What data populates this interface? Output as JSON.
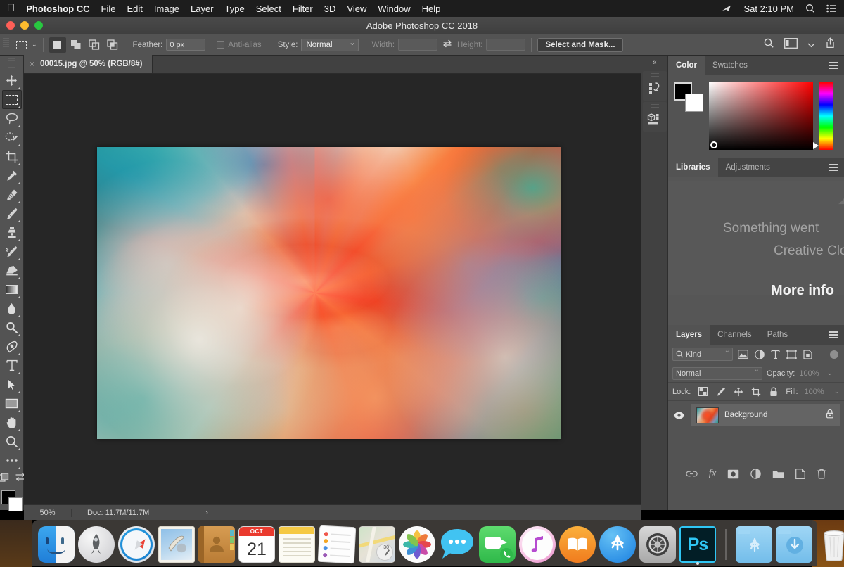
{
  "menubar": {
    "apple_icon": "apple-logo",
    "app_name": "Photoshop CC",
    "items": [
      "File",
      "Edit",
      "Image",
      "Layer",
      "Type",
      "Select",
      "Filter",
      "3D",
      "View",
      "Window",
      "Help"
    ],
    "right": {
      "airplay_icon": "airplay-icon",
      "time": "Sat 2:10 PM",
      "search_icon": "search-icon",
      "control_center_icon": "control-center-icon"
    }
  },
  "titlebar": {
    "title": "Adobe Photoshop CC 2018",
    "close_label": "close",
    "minimize_label": "minimize",
    "zoom_label": "zoom"
  },
  "options_bar": {
    "tool_preset_icon": "rectangular-marquee-icon",
    "selection_modes": [
      "new-selection",
      "add-to-selection",
      "subtract-from-selection",
      "intersect-selection"
    ],
    "feather_label": "Feather:",
    "feather_value": "0 px",
    "antialias_label": "Anti-alias",
    "style_label": "Style:",
    "style_value": "Normal",
    "width_label": "Width:",
    "width_value": "",
    "swap_icon": "swap-arrows-icon",
    "height_label": "Height:",
    "height_value": "",
    "select_and_mask": "Select and Mask...",
    "right_icons": [
      "search-icon",
      "workspace-icon",
      "chevron-down-icon",
      "share-icon"
    ]
  },
  "toolbar": {
    "tools": [
      {
        "name": "move-tool",
        "active": false
      },
      {
        "name": "rectangular-marquee-tool",
        "active": true
      },
      {
        "name": "lasso-tool",
        "active": false
      },
      {
        "name": "quick-selection-tool",
        "active": false
      },
      {
        "name": "crop-tool",
        "active": false
      },
      {
        "name": "eyedropper-tool",
        "active": false
      },
      {
        "name": "spot-healing-brush-tool",
        "active": false
      },
      {
        "name": "brush-tool",
        "active": false
      },
      {
        "name": "clone-stamp-tool",
        "active": false
      },
      {
        "name": "history-brush-tool",
        "active": false
      },
      {
        "name": "eraser-tool",
        "active": false
      },
      {
        "name": "gradient-tool",
        "active": false
      },
      {
        "name": "blur-tool",
        "active": false
      },
      {
        "name": "dodge-tool",
        "active": false
      },
      {
        "name": "pen-tool",
        "active": false
      },
      {
        "name": "horizontal-type-tool",
        "active": false
      },
      {
        "name": "path-selection-tool",
        "active": false
      },
      {
        "name": "rectangle-tool",
        "active": false
      },
      {
        "name": "hand-tool",
        "active": false
      },
      {
        "name": "zoom-tool",
        "active": false
      },
      {
        "name": "edit-toolbar-tool",
        "active": false
      }
    ],
    "quickmask_icon": "quick-mask-icon",
    "screenmode_icon": "screen-mode-icon",
    "foreground_color": "#000000",
    "background_color": "#ffffff"
  },
  "document": {
    "tab_title": "00015.jpg @ 50% (RGB/8#)",
    "tab_close": "×",
    "canvas_bg": "#262626"
  },
  "statusbar": {
    "zoom": "50%",
    "doc_info": "Doc: 11.7M/11.7M",
    "expand_arrow": "›"
  },
  "rail": {
    "collapse_icon": "collapse-panels-icon",
    "items": [
      "history-panel-icon",
      "3d-panel-icon"
    ]
  },
  "color_panel": {
    "tabs": [
      {
        "label": "Color",
        "active": true
      },
      {
        "label": "Swatches",
        "active": false
      }
    ],
    "menu_icon": "panel-menu-icon",
    "foreground": "#000000",
    "background": "#ffffff",
    "field_base_hue": "#ff0000"
  },
  "libraries_panel": {
    "tabs": [
      {
        "label": "Libraries",
        "active": true
      },
      {
        "label": "Adjustments",
        "active": false
      }
    ],
    "menu_icon": "panel-menu-icon",
    "error_line1": "Something went",
    "error_line2": "Creative Clo",
    "more_info_link": "More info"
  },
  "layers_panel": {
    "tabs": [
      {
        "label": "Layers",
        "active": true
      },
      {
        "label": "Channels",
        "active": false
      },
      {
        "label": "Paths",
        "active": false
      }
    ],
    "menu_icon": "panel-menu-icon",
    "filter_label": "Kind",
    "filter_icons": [
      "pixel-filter-icon",
      "adjustment-filter-icon",
      "type-filter-icon",
      "shape-filter-icon",
      "smartobject-filter-icon"
    ],
    "filter_toggle_icon": "filter-enable-toggle",
    "blend_mode": "Normal",
    "opacity_label": "Opacity:",
    "opacity_value": "100%",
    "lock_label": "Lock:",
    "lock_icons": [
      "lock-transparency-icon",
      "lock-image-icon",
      "lock-position-icon",
      "lock-artboard-icon",
      "lock-all-icon"
    ],
    "fill_label": "Fill:",
    "fill_value": "100%",
    "layers": [
      {
        "name": "Background",
        "visible": true,
        "locked": true,
        "eye_icon": "eye-icon",
        "lock_icon": "lock-icon"
      }
    ],
    "bottom_icons": [
      "link-layers-icon",
      "layer-style-fx-icon",
      "layer-mask-icon",
      "adjustment-layer-icon",
      "new-group-icon",
      "new-layer-icon",
      "delete-layer-icon"
    ]
  },
  "dock": {
    "items": [
      {
        "name": "finder",
        "label": "Finder",
        "running": true
      },
      {
        "name": "launchpad",
        "label": "Launchpad",
        "running": false
      },
      {
        "name": "safari",
        "label": "Safari",
        "running": false
      },
      {
        "name": "mail",
        "label": "Mail",
        "running": false
      },
      {
        "name": "contacts",
        "label": "Contacts",
        "running": false
      },
      {
        "name": "calendar",
        "label": "Calendar",
        "running": false,
        "month": "OCT",
        "day": "21"
      },
      {
        "name": "notes",
        "label": "Notes",
        "running": false
      },
      {
        "name": "reminders",
        "label": "Reminders",
        "running": false
      },
      {
        "name": "maps",
        "label": "Maps",
        "running": false
      },
      {
        "name": "photos",
        "label": "Photos",
        "running": false
      },
      {
        "name": "messages",
        "label": "Messages",
        "running": false
      },
      {
        "name": "facetime",
        "label": "FaceTime",
        "running": false
      },
      {
        "name": "itunes",
        "label": "iTunes",
        "running": false
      },
      {
        "name": "ibooks",
        "label": "iBooks",
        "running": false
      },
      {
        "name": "app-store",
        "label": "App Store",
        "running": false
      },
      {
        "name": "system-preferences",
        "label": "System Preferences",
        "running": false
      },
      {
        "name": "photoshop",
        "label": "Ps",
        "running": true
      }
    ],
    "folders": [
      {
        "name": "applications-folder",
        "label": "Applications"
      },
      {
        "name": "downloads-folder",
        "label": "Downloads"
      }
    ],
    "trash": {
      "name": "trash",
      "label": "Trash"
    }
  }
}
